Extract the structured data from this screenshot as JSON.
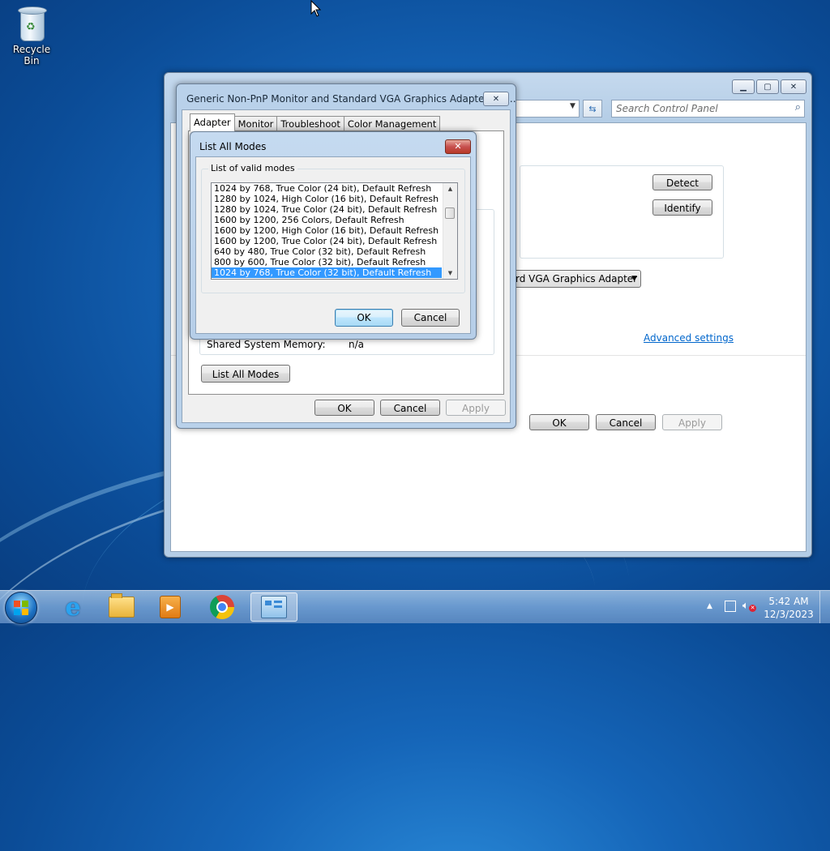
{
  "desktop": {
    "recycle_bin_label": "Recycle Bin"
  },
  "control_panel": {
    "search_placeholder": "Search Control Panel",
    "detect_label": "Detect",
    "identify_label": "Identify",
    "adapter_combo_value": "rd VGA Graphics Adapter",
    "advanced_settings_link": "Advanced settings",
    "ok_label": "OK",
    "cancel_label": "Cancel",
    "apply_label": "Apply"
  },
  "properties_dialog": {
    "title": "Generic Non-PnP Monitor and Standard VGA Graphics Adapter Pro...",
    "tabs": [
      "Adapter",
      "Monitor",
      "Troubleshoot",
      "Color Management"
    ],
    "shared_memory_label": "Shared System Memory:",
    "shared_memory_value": "n/a",
    "list_all_modes_label": "List All Modes",
    "ok_label": "OK",
    "cancel_label": "Cancel",
    "apply_label": "Apply"
  },
  "modes_dialog": {
    "title": "List All Modes",
    "group_label": "List of valid modes",
    "modes": [
      "1024 by 768, True Color (24 bit), Default Refresh",
      "1280 by 1024, High Color (16 bit), Default Refresh",
      "1280 by 1024, True Color (24 bit), Default Refresh",
      "1600 by 1200, 256 Colors, Default Refresh",
      "1600 by 1200, High Color (16 bit), Default Refresh",
      "1600 by 1200, True Color (24 bit), Default Refresh",
      "640 by 480, True Color (32 bit), Default Refresh",
      "800 by 600, True Color (32 bit), Default Refresh",
      "1024 by 768, True Color (32 bit), Default Refresh"
    ],
    "selected_index": 8,
    "ok_label": "OK",
    "cancel_label": "Cancel"
  },
  "taskbar": {
    "apps": [
      "start-orb",
      "internet-explorer",
      "windows-explorer",
      "windows-media-player",
      "google-chrome",
      "control-panel"
    ],
    "clock_time": "5:42 AM",
    "clock_date": "12/3/2023"
  },
  "icons": {
    "search": "search-icon",
    "refresh": "refresh-icon",
    "close": "close-icon"
  },
  "colors": {
    "selection": "#3399ff",
    "link": "#0066cc",
    "desktop": "#1565b8"
  }
}
